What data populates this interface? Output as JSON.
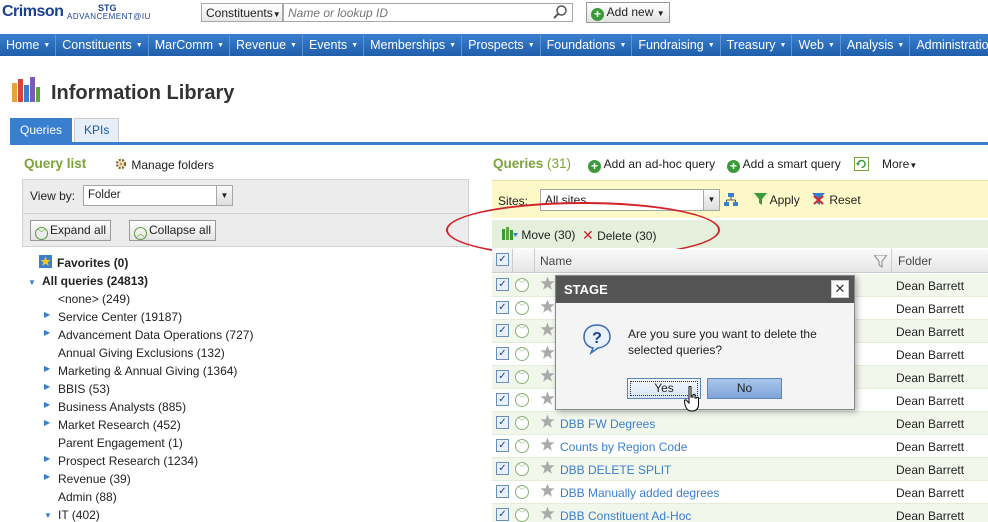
{
  "topbar": {
    "logo_main": "Crimson",
    "logo_sub": "ADVANCEMENT@IU",
    "logo_env": "STG",
    "search_type": "Constituents",
    "search_placeholder": "Name or lookup ID",
    "add_new": "Add new"
  },
  "nav": [
    "Home",
    "Constituents",
    "MarComm",
    "Revenue",
    "Events",
    "Memberships",
    "Prospects",
    "Foundations",
    "Fundraising",
    "Treasury",
    "Web",
    "Analysis",
    "Administration"
  ],
  "page": {
    "title": "Information Library"
  },
  "tabs": {
    "queries": "Queries",
    "kpis": "KPIs"
  },
  "left": {
    "title": "Query list",
    "manage_folders": "Manage folders",
    "view_by_label": "View by:",
    "view_by_value": "Folder",
    "expand_all": "Expand all",
    "collapse_all": "Collapse all",
    "tree": [
      {
        "label": "Favorites (0)"
      },
      {
        "label": "All queries (24813)"
      },
      {
        "label": "<none> (249)"
      },
      {
        "label": "Service Center (19187)"
      },
      {
        "label": "Advancement Data Operations (727)"
      },
      {
        "label": "Annual Giving Exclusions (132)"
      },
      {
        "label": "Marketing & Annual Giving (1364)"
      },
      {
        "label": "BBIS (53)"
      },
      {
        "label": "Business Analysts (885)"
      },
      {
        "label": "Market Research (452)"
      },
      {
        "label": "Parent Engagement (1)"
      },
      {
        "label": "Prospect Research (1234)"
      },
      {
        "label": "Revenue (39)"
      },
      {
        "label": "Admin (88)"
      },
      {
        "label": "IT (402)"
      }
    ]
  },
  "right": {
    "title": "Queries",
    "count": "(31)",
    "add_adhoc": "Add an ad-hoc query",
    "add_smart": "Add a smart query",
    "more": "More",
    "sites_label": "Sites:",
    "sites_value": "All sites",
    "apply": "Apply",
    "reset": "Reset",
    "move": "Move (30)",
    "delete": "Delete (30)",
    "col_name": "Name",
    "col_folder": "Folder",
    "rows": [
      {
        "name": "",
        "folder": "Dean Barrett"
      },
      {
        "name": "",
        "folder": "Dean Barrett"
      },
      {
        "name": "",
        "folder": "Dean Barrett"
      },
      {
        "name": "",
        "folder": "Dean Barrett"
      },
      {
        "name": "",
        "folder": "Dean Barrett"
      },
      {
        "name": "",
        "folder": "Dean Barrett"
      },
      {
        "name": "DBB FW Degrees",
        "folder": "Dean Barrett"
      },
      {
        "name": "Counts by Region Code",
        "folder": "Dean Barrett"
      },
      {
        "name": "DBB DELETE SPLIT",
        "folder": "Dean Barrett"
      },
      {
        "name": "DBB Manually added degrees",
        "folder": "Dean Barrett"
      },
      {
        "name": "DBB Constituent Ad-Hoc",
        "folder": "Dean Barrett"
      }
    ]
  },
  "dialog": {
    "title": "STAGE",
    "message": "Are you sure you want to delete the selected queries?",
    "yes": "Yes",
    "no": "No"
  },
  "colors": {
    "nav_blue": "#1f5eaa",
    "accent_green": "#7aa33a",
    "highlight_red": "#d4222a"
  }
}
